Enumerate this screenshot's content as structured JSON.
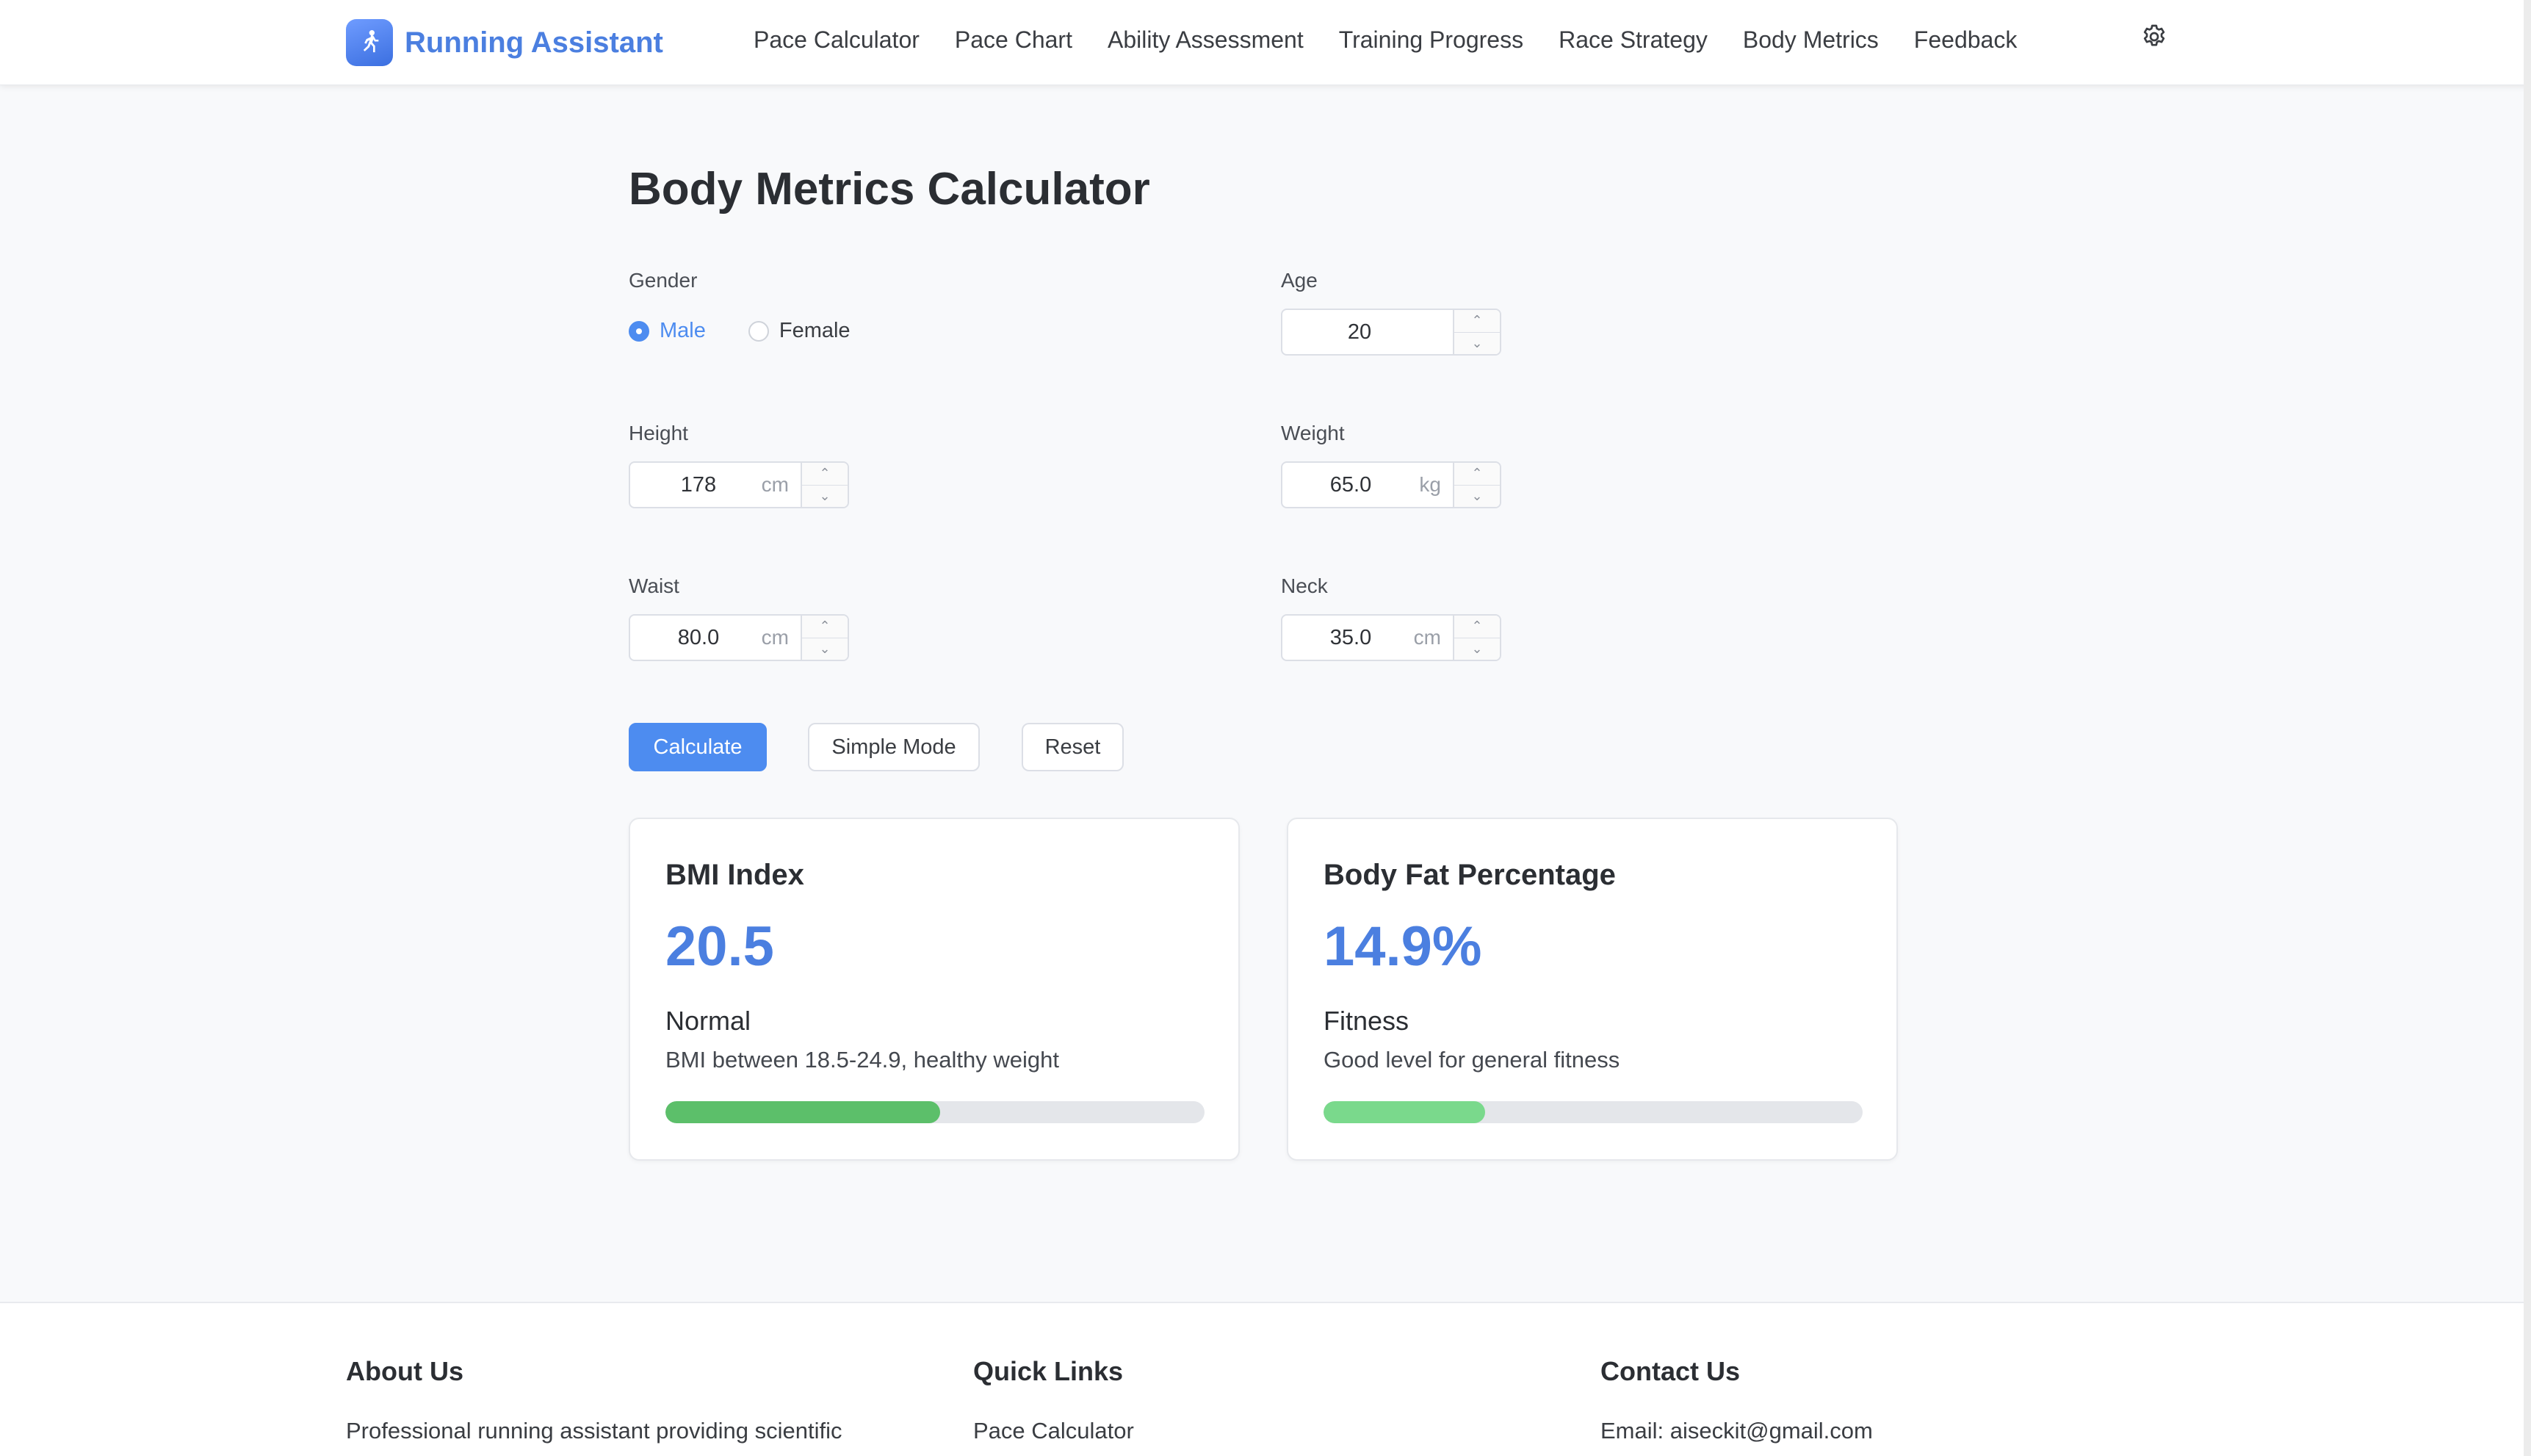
{
  "app": {
    "name": "Running Assistant"
  },
  "nav": {
    "items": [
      "Pace Calculator",
      "Pace Chart",
      "Ability Assessment",
      "Training Progress",
      "Race Strategy",
      "Body Metrics",
      "Feedback"
    ]
  },
  "icons": {
    "logo": "runner-icon",
    "settings": "gear-icon",
    "stepper_up": "chevron-up-icon",
    "stepper_down": "chevron-down-icon"
  },
  "colors": {
    "accent": "#4d8cf0",
    "brand_text": "#4b7fe0",
    "bmi_bar": "#5cbf6a",
    "fat_bar": "#7ad98c"
  },
  "page": {
    "title": "Body Metrics Calculator"
  },
  "form": {
    "gender": {
      "label": "Gender",
      "options": [
        "Male",
        "Female"
      ],
      "selected": "Male"
    },
    "age": {
      "label": "Age",
      "value": "20",
      "unit": ""
    },
    "height": {
      "label": "Height",
      "value": "178",
      "unit": "cm"
    },
    "weight": {
      "label": "Weight",
      "value": "65.0",
      "unit": "kg"
    },
    "waist": {
      "label": "Waist",
      "value": "80.0",
      "unit": "cm"
    },
    "neck": {
      "label": "Neck",
      "value": "35.0",
      "unit": "cm"
    }
  },
  "buttons": {
    "calculate": "Calculate",
    "simple_mode": "Simple Mode",
    "reset": "Reset"
  },
  "results": {
    "bmi": {
      "title": "BMI Index",
      "value": "20.5",
      "status": "Normal",
      "description": "BMI between 18.5-24.9, healthy weight",
      "progress": 0.51
    },
    "body_fat": {
      "title": "Body Fat Percentage",
      "value": "14.9%",
      "status": "Fitness",
      "description": "Good level for general fitness",
      "progress": 0.3
    }
  },
  "footer": {
    "about": {
      "title": "About Us",
      "text": "Professional running assistant providing scientific"
    },
    "quick_links": {
      "title": "Quick Links",
      "first_link": "Pace Calculator"
    },
    "contact": {
      "title": "Contact Us",
      "email": "Email: aiseckit@gmail.com"
    }
  }
}
